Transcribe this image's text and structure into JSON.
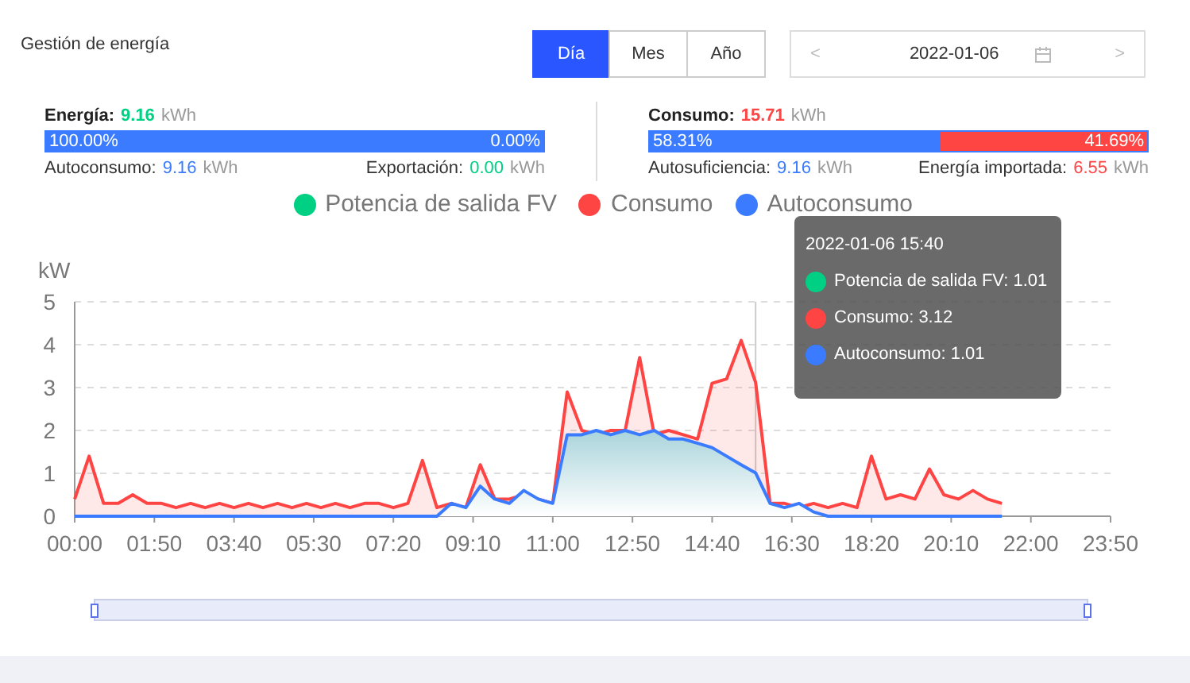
{
  "title": "Gestión de energía",
  "period_tabs": [
    {
      "label": "Día",
      "selected": true
    },
    {
      "label": "Mes",
      "selected": false
    },
    {
      "label": "Año",
      "selected": false
    }
  ],
  "date_picker": {
    "prev": "<",
    "value": "2022-01-06",
    "next": ">"
  },
  "summary": [
    {
      "label": "Energía:",
      "value": "9.16",
      "unit": "kWh",
      "color": "#00d084",
      "level": 1,
      "left_pct": "100.00%",
      "right_pct": "0.00%",
      "details": [
        {
          "label": "Autoconsumo:",
          "value": "9.16",
          "unit": "kWh",
          "color": "#3a7bff"
        },
        {
          "label": "Exportación:",
          "value": "0.00",
          "unit": "kWh",
          "color": "#00d084"
        }
      ]
    },
    {
      "label": "Consumo:",
      "value": "15.71",
      "unit": "kWh",
      "color": "#ff4444",
      "level": 0.5831,
      "left_pct": "58.31%",
      "right_pct": "41.69%",
      "details": [
        {
          "label": "Autosuficiencia:",
          "value": "9.16",
          "unit": "kWh",
          "color": "#3a7bff"
        },
        {
          "label": "Energía importada:",
          "value": "6.55",
          "unit": "kWh",
          "color": "#ff4444"
        }
      ]
    }
  ],
  "chart": {
    "legend_items": [
      {
        "name": "Potencia de salida FV",
        "color": "#00d084"
      }
    ],
    "zoom_slider": {
      "level": 1
    },
    "chart_data": {
      "type": "area",
      "legend": "top",
      "grid": "y",
      "ref_lines": [
        {
          "axis": "x",
          "value": 940
        }
      ],
      "ylabel": "kW",
      "ylim": [
        0,
        5
      ],
      "yticks": [
        0,
        1,
        2,
        3,
        4,
        5
      ],
      "xlim": [
        0,
        1430
      ],
      "xticks": [
        {
          "value": 0,
          "label": "00:00"
        },
        {
          "value": 110,
          "label": "01:50"
        },
        {
          "value": 220,
          "label": "03:40"
        },
        {
          "value": 330,
          "label": "05:30"
        },
        {
          "value": 440,
          "label": "07:20"
        },
        {
          "value": 550,
          "label": "09:10"
        },
        {
          "value": 660,
          "label": "11:00"
        },
        {
          "value": 770,
          "label": "12:50"
        },
        {
          "value": 880,
          "label": "14:40"
        },
        {
          "value": 990,
          "label": "16:30"
        },
        {
          "value": 1100,
          "label": "18:20"
        },
        {
          "value": 1210,
          "label": "20:10"
        },
        {
          "value": 1320,
          "label": "22:00"
        },
        {
          "value": 1430,
          "label": "23:50"
        }
      ],
      "x": [
        0,
        20,
        40,
        60,
        80,
        100,
        120,
        140,
        160,
        180,
        200,
        220,
        240,
        260,
        280,
        300,
        320,
        340,
        360,
        380,
        400,
        420,
        440,
        460,
        480,
        500,
        520,
        540,
        560,
        580,
        600,
        620,
        640,
        660,
        680,
        700,
        720,
        740,
        760,
        780,
        800,
        820,
        840,
        860,
        880,
        900,
        920,
        940,
        960,
        980,
        1000,
        1020,
        1040,
        1060,
        1080,
        1100,
        1120,
        1140,
        1160,
        1180,
        1200,
        1220,
        1240,
        1260,
        1280
      ],
      "series": [
        {
          "name": "Consumo",
          "color": "#ff4444",
          "values": [
            0.4,
            1.4,
            0.3,
            0.3,
            0.5,
            0.3,
            0.3,
            0.2,
            0.3,
            0.2,
            0.3,
            0.2,
            0.3,
            0.2,
            0.3,
            0.2,
            0.3,
            0.2,
            0.3,
            0.2,
            0.3,
            0.3,
            0.2,
            0.3,
            1.3,
            0.2,
            0.3,
            0.2,
            1.2,
            0.4,
            0.4,
            0.5,
            0.4,
            0.3,
            2.9,
            2.0,
            1.9,
            2.0,
            2.0,
            3.7,
            1.9,
            2.0,
            1.9,
            1.8,
            3.1,
            3.2,
            4.1,
            3.12,
            0.3,
            0.3,
            0.2,
            0.3,
            0.2,
            0.3,
            0.2,
            1.4,
            0.4,
            0.5,
            0.4,
            1.1,
            0.5,
            0.4,
            0.6,
            0.4,
            0.3
          ]
        },
        {
          "name": "Autoconsumo",
          "color": "#3a7bff",
          "values": [
            0,
            0,
            0,
            0,
            0,
            0,
            0,
            0,
            0,
            0,
            0,
            0,
            0,
            0,
            0,
            0,
            0,
            0,
            0,
            0,
            0,
            0,
            0,
            0,
            0,
            0,
            0.3,
            0.2,
            0.7,
            0.4,
            0.3,
            0.6,
            0.4,
            0.3,
            1.9,
            1.9,
            2.0,
            1.9,
            2.0,
            1.9,
            2.0,
            1.8,
            1.8,
            1.7,
            1.6,
            1.4,
            1.2,
            1.01,
            0.3,
            0.2,
            0.3,
            0.1,
            0,
            0,
            0,
            0,
            0,
            0,
            0,
            0,
            0,
            0,
            0,
            0,
            0
          ]
        }
      ]
    },
    "tooltip": {
      "time": "2022-01-06 15:40",
      "rows": [
        {
          "text": "Potencia de salida FV: 1.01",
          "color": "#00d084"
        },
        {
          "text": "Consumo: 3.12",
          "color": "#ff4444"
        },
        {
          "text": "Autoconsumo: 1.01",
          "color": "#3a7bff"
        }
      ]
    }
  }
}
